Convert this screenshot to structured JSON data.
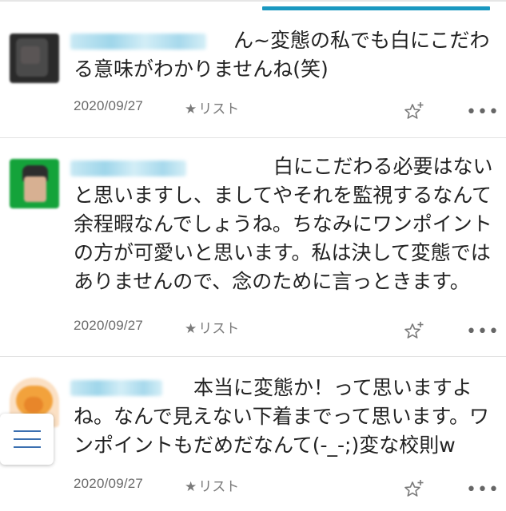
{
  "comments": [
    {
      "text": "　　　　　　　　ん~変態の私でも白にこだわる意味がわかりませんね(笑)",
      "date": "2020/09/27",
      "list_label": "リスト",
      "star_icon": "star-filled-icon",
      "add_star_icon": "star-add-icon",
      "more_icon": "more-horizontal-icon"
    },
    {
      "text": "　　　　　　　　　　白にこだわる必要はないと思いますし、ましてやそれを監視するなんて余程暇なんでしょうね。ちなみにワンポイントの方が可愛いと思います。私は決して変態ではありませんので、念のために言っときます。",
      "date": "2020/09/27",
      "list_label": "リスト",
      "star_icon": "star-filled-icon",
      "add_star_icon": "star-add-icon",
      "more_icon": "more-horizontal-icon"
    },
    {
      "text": "　　　　　　本当に変態か！って思いますよね。なんで見えない下着までって思います。ワンポイントもだめだなんて(-_-;)変な校則w",
      "date": "2020/09/27",
      "list_label": "リスト",
      "star_icon": "star-filled-icon",
      "add_star_icon": "star-add-icon",
      "more_icon": "more-horizontal-icon"
    }
  ],
  "colors": {
    "accent": "#1a98c0",
    "text": "#222222",
    "meta": "#6b6b6b",
    "menu_icon": "#3b6fb0"
  },
  "menu_icon": "hamburger-menu-icon"
}
